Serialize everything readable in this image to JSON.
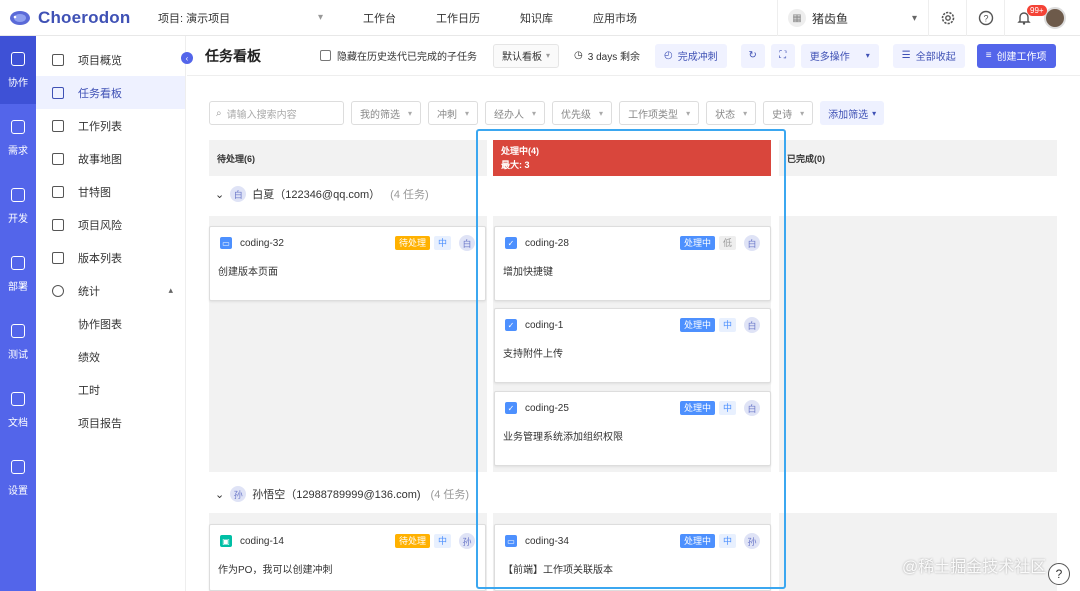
{
  "app": {
    "name": "Choerodon"
  },
  "topbar": {
    "project_select": "项目: 演示项目",
    "nav": [
      "工作台",
      "工作日历",
      "知识库",
      "应用市场"
    ],
    "org_select": "猪齿鱼",
    "notification_badge": "99+"
  },
  "rail": [
    {
      "label": "协作",
      "active": true
    },
    {
      "label": "需求"
    },
    {
      "label": "开发"
    },
    {
      "label": "部署"
    },
    {
      "label": "测试"
    },
    {
      "label": "文档"
    },
    {
      "label": "设置"
    }
  ],
  "menu": {
    "items": [
      "项目概览",
      "任务看板",
      "工作列表",
      "故事地图",
      "甘特图",
      "项目风险",
      "版本列表",
      "统计"
    ],
    "active": "任务看板",
    "sub_items": [
      "协作图表",
      "绩效",
      "工时",
      "项目报告"
    ]
  },
  "header": {
    "title": "任务看板",
    "hide_subtasks": "隐藏在历史迭代已完成的子任务",
    "board_select": "默认看板",
    "sprint_remaining": "3 days 剩余",
    "complete_sprint": "完成冲刺",
    "more_actions": "更多操作",
    "collapse_all": "全部收起",
    "create_issue": "创建工作项"
  },
  "filters": {
    "search_placeholder": "请输入搜索内容",
    "selects": [
      "我的筛选",
      "冲刺",
      "经办人",
      "优先级",
      "工作项类型",
      "状态",
      "史诗"
    ],
    "add_filter": "添加筛选"
  },
  "columns": {
    "todo": "待处理(6)",
    "doing": "处理中(4)",
    "doing_max": "最大: 3",
    "done": "已完成(0)"
  },
  "swimlanes": [
    {
      "avatar": "白",
      "name": "白夏（122346@qq.com）",
      "count": "(4 任务)"
    },
    {
      "avatar": "孙",
      "name": "孙悟空（12988789999@136.com)",
      "count": "(4 任务)"
    }
  ],
  "cards": [
    {
      "code": "coding-32",
      "status": "待处理",
      "priority": "中",
      "assignee": "白",
      "summary": "创建版本页面"
    },
    {
      "code": "coding-28",
      "status": "处理中",
      "priority": "低",
      "assignee": "白",
      "summary": "增加快捷键"
    },
    {
      "code": "coding-1",
      "status": "处理中",
      "priority": "中",
      "assignee": "白",
      "summary": "支持附件上传"
    },
    {
      "code": "coding-25",
      "status": "处理中",
      "priority": "中",
      "assignee": "白",
      "summary": "业务管理系统添加组织权限"
    },
    {
      "code": "coding-14",
      "status": "待处理",
      "priority": "中",
      "assignee": "孙",
      "summary": "作为PO，我可以创建冲刺"
    },
    {
      "code": "coding-34",
      "status": "处理中",
      "priority": "中",
      "assignee": "孙",
      "summary": "【前端】工作项关联版本"
    }
  ],
  "watermark": "@稀土掘金技术社区",
  "colors": {
    "accent": "#5365ea",
    "doing_header": "#d9463c",
    "highlight": "#3ba7f0"
  }
}
